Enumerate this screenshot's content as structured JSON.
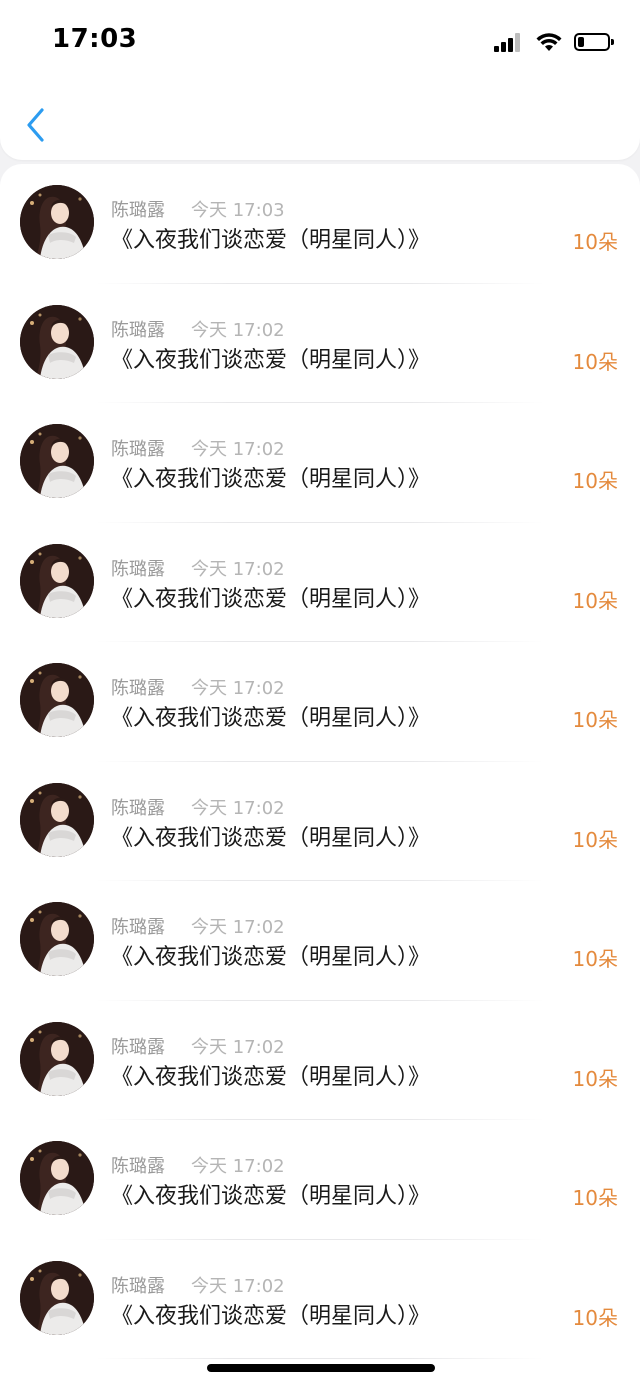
{
  "status_bar": {
    "time": "17:03",
    "battery_level": 0.22
  },
  "icons": {
    "back": "chevron-left-icon",
    "signal": "cellular-signal-icon",
    "wifi": "wifi-icon",
    "battery": "battery-icon"
  },
  "colors": {
    "accent_blue": "#2c9cf0",
    "count_orange": "#e48a3d",
    "meta_gray": "#9a9a9a"
  },
  "list": {
    "items": [
      {
        "name": "陈璐露",
        "time": "今天 17:03",
        "title": "《入夜我们谈恋爱（明星同人）》",
        "count": "10朵"
      },
      {
        "name": "陈璐露",
        "time": "今天 17:02",
        "title": "《入夜我们谈恋爱（明星同人）》",
        "count": "10朵"
      },
      {
        "name": "陈璐露",
        "time": "今天 17:02",
        "title": "《入夜我们谈恋爱（明星同人）》",
        "count": "10朵"
      },
      {
        "name": "陈璐露",
        "time": "今天 17:02",
        "title": "《入夜我们谈恋爱（明星同人）》",
        "count": "10朵"
      },
      {
        "name": "陈璐露",
        "time": "今天 17:02",
        "title": "《入夜我们谈恋爱（明星同人）》",
        "count": "10朵"
      },
      {
        "name": "陈璐露",
        "time": "今天 17:02",
        "title": "《入夜我们谈恋爱（明星同人）》",
        "count": "10朵"
      },
      {
        "name": "陈璐露",
        "time": "今天 17:02",
        "title": "《入夜我们谈恋爱（明星同人）》",
        "count": "10朵"
      },
      {
        "name": "陈璐露",
        "time": "今天 17:02",
        "title": "《入夜我们谈恋爱（明星同人）》",
        "count": "10朵"
      },
      {
        "name": "陈璐露",
        "time": "今天 17:02",
        "title": "《入夜我们谈恋爱（明星同人）》",
        "count": "10朵"
      },
      {
        "name": "陈璐露",
        "time": "今天 17:02",
        "title": "《入夜我们谈恋爱（明星同人）》",
        "count": "10朵"
      }
    ]
  }
}
